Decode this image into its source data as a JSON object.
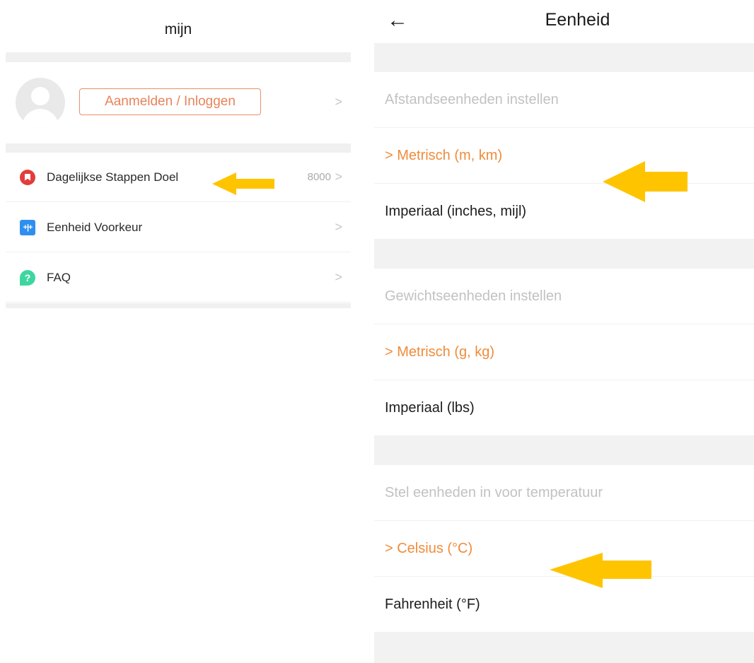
{
  "left": {
    "title": "mijn",
    "login_label": "Aanmelden / Inloggen",
    "menu": [
      {
        "label": "Dagelijkse Stappen Doel",
        "value": "8000",
        "icon": "bookmark-icon"
      },
      {
        "label": "Eenheid Voorkeur",
        "value": "",
        "icon": "sliders-icon"
      },
      {
        "label": "FAQ",
        "value": "",
        "icon": "question-icon"
      }
    ]
  },
  "right": {
    "title": "Eenheid",
    "sections": [
      {
        "header": "Afstandseenheden instellen",
        "selected": "> Metrisch (m, km)",
        "other": "Imperiaal (inches, mijl)"
      },
      {
        "header": "Gewichtseenheden instellen",
        "selected": "> Metrisch (g, kg)",
        "other": "Imperiaal (lbs)"
      },
      {
        "header": "Stel eenheden in voor temperatuur",
        "selected": "> Celsius  (°C)",
        "other": "Fahrenheit (°F)"
      }
    ]
  },
  "colors": {
    "accent": "#ef8c3a",
    "arrow": "#ffc400",
    "separator": "#f0f0f0"
  }
}
